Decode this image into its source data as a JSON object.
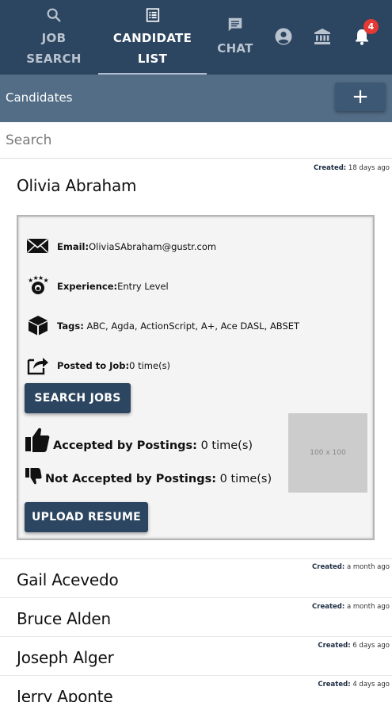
{
  "nav": {
    "job_search_line1": "JOB",
    "job_search_line2": "SEARCH",
    "candidate_list_line1": "CANDIDATE",
    "candidate_list_line2": "LIST",
    "chat": "CHAT",
    "notification_count": "4",
    "icons": [
      "search-icon",
      "list-icon",
      "chat-icon",
      "account-icon",
      "bank-icon",
      "bell-icon"
    ]
  },
  "header": {
    "title": "Candidates",
    "add_label": "+"
  },
  "search": {
    "placeholder": "Search"
  },
  "expanded": {
    "name": "Olivia Abraham",
    "created_label": "Created:",
    "created_value": "18 days ago",
    "email_label": "Email:",
    "email": "OliviaSAbraham@gustr.com",
    "experience_label": "Experience:",
    "experience": "Entry Level",
    "tags_label": "Tags:",
    "tags": "ABC, Agda, ActionScript, A+, Ace DASL, ABSET",
    "posted_label": "Posted to Job:",
    "posted": "0 time(s)",
    "search_jobs_button": "SEARCH JOBS",
    "accepted_label": "Accepted by Postings:",
    "accepted": "0 time(s)",
    "not_accepted_label": "Not Accepted by Postings:",
    "not_accepted": "0 time(s)",
    "upload_button": "UPLOAD RESUME",
    "image_placeholder": "100 x 100"
  },
  "candidates": [
    {
      "name": "Gail Acevedo",
      "created_label": "Created:",
      "created_value": "a month ago"
    },
    {
      "name": "Bruce Alden",
      "created_label": "Created:",
      "created_value": "a month ago"
    },
    {
      "name": "Joseph Alger",
      "created_label": "Created:",
      "created_value": "6 days ago"
    },
    {
      "name": "Jerry Aponte",
      "created_label": "Created:",
      "created_value": "4 days ago"
    }
  ],
  "colors": {
    "nav_bg": "#2c4560",
    "subbar_bg": "#536d86",
    "button_bg": "#2c4560",
    "badge": "#e53935"
  }
}
